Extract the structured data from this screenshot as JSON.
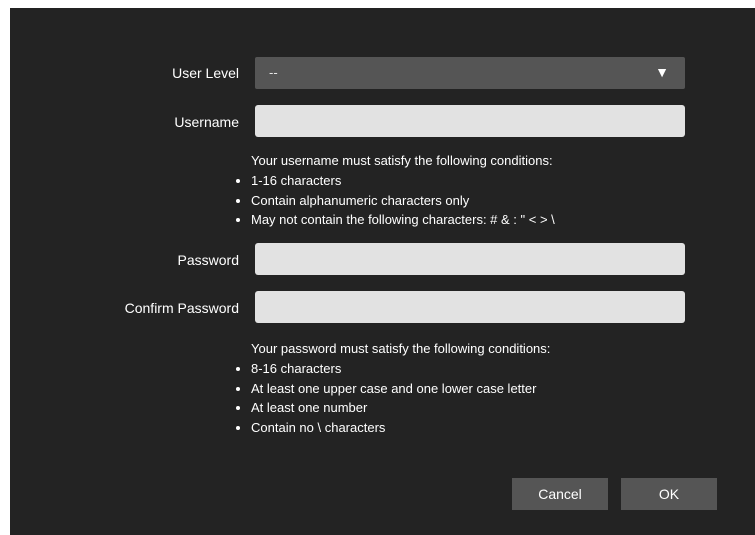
{
  "form": {
    "user_level_label": "User Level",
    "user_level_value": "--",
    "username_label": "Username",
    "username_value": "",
    "password_label": "Password",
    "password_value": "",
    "confirm_password_label": "Confirm Password",
    "confirm_password_value": ""
  },
  "username_rules": {
    "intro": "Your username must satisfy the following conditions:",
    "items": [
      "1-16 characters",
      "Contain alphanumeric characters only",
      "May not contain the following characters: # & : \" < > \\"
    ]
  },
  "password_rules": {
    "intro": "Your password must satisfy the following conditions:",
    "items": [
      "8-16 characters",
      "At least one upper case and one lower case letter",
      "At least one number",
      "Contain no \\ characters"
    ]
  },
  "buttons": {
    "cancel": "Cancel",
    "ok": "OK"
  },
  "icons": {
    "select_arrow": "triangle-down",
    "password_toggle": "eye-off-icon"
  },
  "colors": {
    "background": "#232323",
    "input": "#e2e2e2",
    "select": "#555555",
    "button": "#555555"
  }
}
